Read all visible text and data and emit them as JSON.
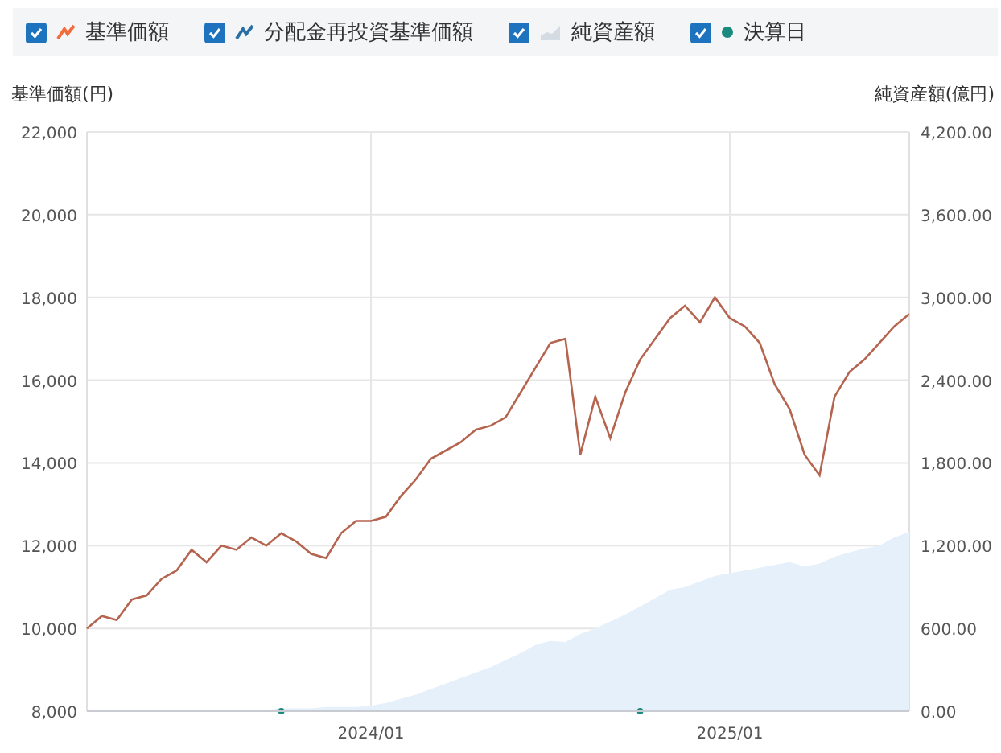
{
  "legend": [
    {
      "label": "基準価額",
      "checked": true,
      "kind": "line",
      "color": "#f26b3a"
    },
    {
      "label": "分配金再投資基準価額",
      "checked": true,
      "kind": "line",
      "color": "#2a6ea6"
    },
    {
      "label": "純資産額",
      "checked": true,
      "kind": "area",
      "color": "#d5dbe3"
    },
    {
      "label": "決算日",
      "checked": true,
      "kind": "dot",
      "color": "#1b8a7e"
    }
  ],
  "left_axis_title": "基準価額(円)",
  "right_axis_title": "純資産額(億円)",
  "chart_data": {
    "type": "line",
    "grid": true,
    "categories": [
      null,
      null,
      null,
      null,
      null,
      null,
      null,
      null,
      null,
      null,
      null,
      null,
      null,
      null,
      null,
      null,
      null,
      null,
      null,
      "2024/01",
      null,
      null,
      null,
      null,
      null,
      null,
      null,
      null,
      null,
      null,
      null,
      null,
      null,
      null,
      null,
      null,
      null,
      null,
      null,
      null,
      null,
      null,
      null,
      "2025/01",
      null,
      null,
      null,
      null,
      null,
      null,
      null,
      null,
      null,
      null,
      null,
      null
    ],
    "yticks": [
      {
        "value": 8000,
        "label": "8,000"
      },
      {
        "value": 10000,
        "label": "10,000"
      },
      {
        "value": 12000,
        "label": "12,000"
      },
      {
        "value": 14000,
        "label": "14,000"
      },
      {
        "value": 16000,
        "label": "16,000"
      },
      {
        "value": 18000,
        "label": "18,000"
      },
      {
        "value": 20000,
        "label": "20,000"
      },
      {
        "value": 22000,
        "label": "22,000"
      }
    ],
    "ylim": [
      8000,
      22000
    ],
    "y2ticks": [
      {
        "value": 0,
        "label": "0.00"
      },
      {
        "value": 600,
        "label": "600.00"
      },
      {
        "value": 1200,
        "label": "1,200.00"
      },
      {
        "value": 1800,
        "label": "1,800.00"
      },
      {
        "value": 2400,
        "label": "2,400.00"
      },
      {
        "value": 3000,
        "label": "3,000.00"
      },
      {
        "value": 3600,
        "label": "3,600.00"
      },
      {
        "value": 4200,
        "label": "4,200.00"
      }
    ],
    "y2lim": [
      0,
      4200
    ],
    "series": [
      {
        "color": "#b5644f",
        "type": "line",
        "values": [
          10000,
          10300,
          10200,
          10700,
          10800,
          11200,
          11400,
          11900,
          11600,
          12000,
          11900,
          12200,
          12000,
          12300,
          12100,
          11800,
          11700,
          12300,
          12600,
          12600,
          12700,
          13200,
          13600,
          14100,
          14300,
          14500,
          14800,
          14900,
          15100,
          15700,
          16300,
          16900,
          17000,
          14200,
          15600,
          14600,
          15700,
          16500,
          17000,
          17500,
          17800,
          17400,
          18000,
          17500,
          17300,
          16900,
          15900,
          15300,
          14200,
          13700,
          15600,
          16200,
          16500,
          16900,
          17300,
          17600
        ]
      },
      {
        "color": "#e6f0fa",
        "type": "area",
        "axis": "y2",
        "values": [
          0,
          0,
          0,
          0,
          0,
          0,
          10,
          10,
          10,
          10,
          10,
          10,
          10,
          20,
          20,
          20,
          30,
          30,
          30,
          40,
          60,
          90,
          120,
          160,
          200,
          240,
          280,
          320,
          370,
          420,
          480,
          510,
          500,
          560,
          600,
          650,
          700,
          760,
          820,
          880,
          900,
          940,
          980,
          1000,
          1020,
          1040,
          1060,
          1080,
          1050,
          1070,
          1120,
          1150,
          1180,
          1200,
          1260,
          1300
        ]
      },
      {
        "color": "#1b8a7e",
        "type": "scatter",
        "axis": "y2",
        "values": [
          null,
          null,
          null,
          null,
          null,
          null,
          null,
          null,
          null,
          null,
          null,
          null,
          null,
          0,
          null,
          null,
          null,
          null,
          null,
          null,
          null,
          null,
          null,
          null,
          null,
          null,
          null,
          null,
          null,
          null,
          null,
          null,
          null,
          null,
          null,
          null,
          null,
          0,
          null,
          null,
          null,
          null,
          null,
          null,
          null,
          null,
          null,
          null,
          null,
          null,
          null,
          null,
          null,
          null,
          null,
          null
        ]
      }
    ]
  }
}
